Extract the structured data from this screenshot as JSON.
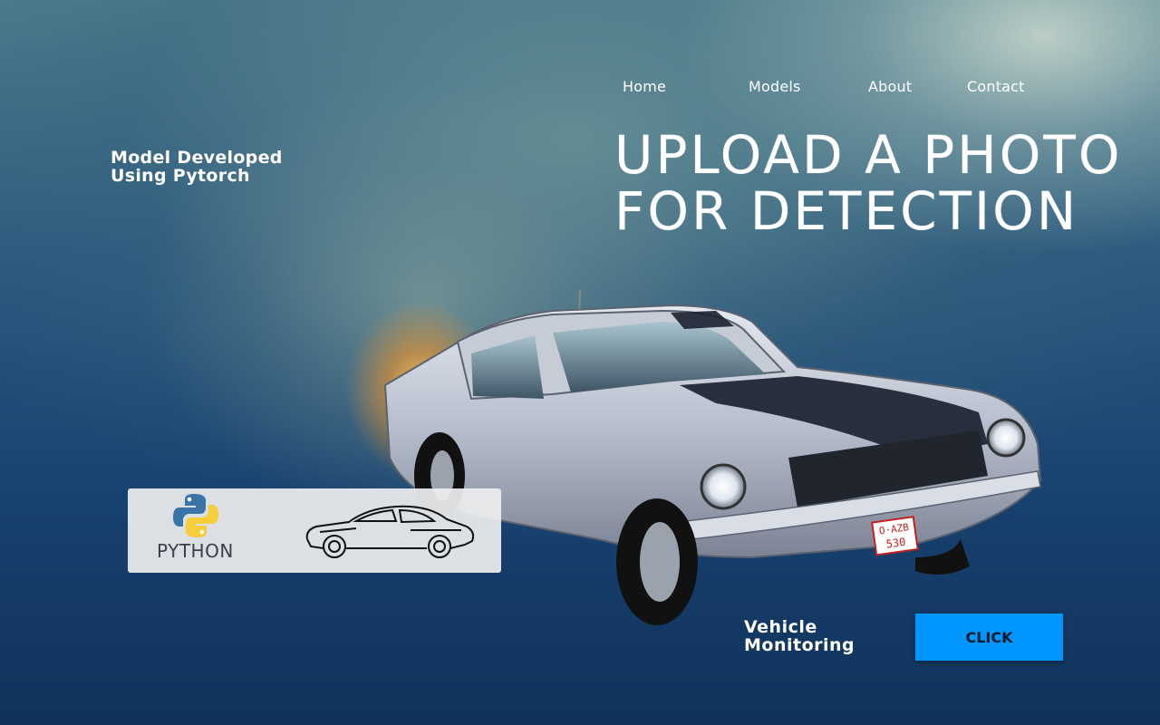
{
  "nav": {
    "home": "Home",
    "models": "Models",
    "about": "About",
    "contact": "Contact"
  },
  "hero": {
    "tagline_line1": "Model Developed",
    "tagline_line2": "Using Pytorch",
    "headline_line1": "UPLOAD A PHOTO",
    "headline_line2": "FOR DETECTION"
  },
  "badge": {
    "python_label": "PYTHON"
  },
  "car_photo": {
    "plate_line1": "O·AZB",
    "plate_line2": "530"
  },
  "footer": {
    "vm_line1": "Vehicle",
    "vm_line2": "Monitoring",
    "cta_label": "CLICK"
  },
  "colors": {
    "accent": "#0096ff",
    "python_blue": "#3b74a7",
    "python_yellow": "#f7cd3a"
  },
  "icons": [
    "python-logo-icon",
    "car-sketch-icon"
  ]
}
